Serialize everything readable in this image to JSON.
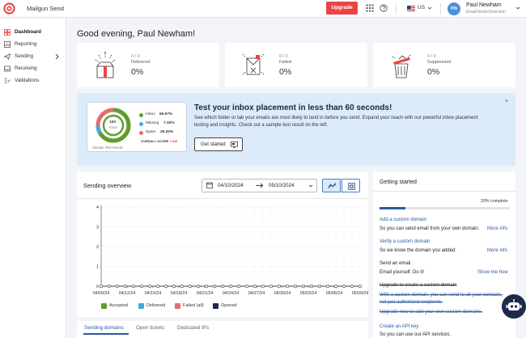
{
  "header": {
    "app_title": "Mailgun Send",
    "upgrade_label": "Upgrade",
    "region": "US",
    "user_initials": "PN",
    "user_name": "Paul Newham",
    "user_account": "EmailVendorSelection"
  },
  "sidebar": {
    "items": [
      {
        "label": "Dashboard",
        "icon": "dashboard-icon"
      },
      {
        "label": "Reporting",
        "icon": "reporting-icon"
      },
      {
        "label": "Sending",
        "icon": "send-icon"
      },
      {
        "label": "Receiving",
        "icon": "receiving-icon"
      },
      {
        "label": "Validations",
        "icon": "validations-icon"
      }
    ]
  },
  "main": {
    "greeting": "Good evening, Paul Newham!",
    "stats": [
      {
        "ratio": "0 / 0",
        "label": "Delivered",
        "percent": "0%"
      },
      {
        "ratio": "0 / 0",
        "label": "Failed",
        "percent": "0%"
      },
      {
        "ratio": "0 / 0",
        "label": "Suppressed",
        "percent": "0%"
      }
    ]
  },
  "promo": {
    "title": "Test your inbox placement in less than 60 seconds!",
    "description": "See which folder or tab your emails are most likely to land in before you send. Expand your reach with our powerful inbox placement testing and insights. Check out a sample test result on the left.",
    "button_label": "Get started",
    "close": "×",
    "sample": {
      "score": "100",
      "score_label": "Inbox",
      "rows": [
        {
          "label": "Inbox",
          "value": "66.67%",
          "color": "#5aa02c"
        },
        {
          "label": "Missing",
          "value": "7.33%",
          "color": "#4aa3df"
        },
        {
          "label": "Spam",
          "value": "26.00%",
          "color": "#e86a6a"
        }
      ],
      "overall_label": "OVERALL SCORE",
      "overall_value": "LOW",
      "caption": "Sample Test Result"
    }
  },
  "overview": {
    "title": "Sending overview",
    "date_from": "04/10/2024",
    "date_to": "05/10/2024"
  },
  "chart_data": {
    "type": "line",
    "categories": [
      "04/09/24",
      "04/12/24",
      "04/15/24",
      "04/18/24",
      "04/21/24",
      "04/24/24",
      "04/27/24",
      "04/30/24",
      "05/03/24",
      "05/06/24",
      "05/09/24"
    ],
    "ylim": [
      0,
      4
    ],
    "yticks": [
      "0",
      "1",
      "2",
      "3",
      "4"
    ],
    "series": [
      {
        "name": "Accepted",
        "color": "#5aa02c",
        "values": [
          0,
          0,
          0,
          0,
          0,
          0,
          0,
          0,
          0,
          0,
          0
        ]
      },
      {
        "name": "Delivered",
        "color": "#4aa3df",
        "values": [
          0,
          0,
          0,
          0,
          0,
          0,
          0,
          0,
          0,
          0,
          0
        ]
      },
      {
        "name": "Failed (all)",
        "color": "#e86a6a",
        "values": [
          0,
          0,
          0,
          0,
          0,
          0,
          0,
          0,
          0,
          0,
          0
        ]
      },
      {
        "name": "Opened",
        "color": "#1c2b4a",
        "values": [
          0,
          0,
          0,
          0,
          0,
          0,
          0,
          0,
          0,
          0,
          0
        ]
      }
    ],
    "grid": true
  },
  "tabs": [
    {
      "label": "Sending domains"
    },
    {
      "label": "Open tickets"
    },
    {
      "label": "Dedicated IPs"
    }
  ],
  "getting_started": {
    "title": "Getting started",
    "complete": "20% complete",
    "progress": 0.2,
    "add_domain": "Add a custom domain",
    "add_domain_desc": "So you can send email from your own domain.",
    "more_info_1": "More info",
    "verify_domain": "Verify a custom domain",
    "verify_desc": "So we know the domain you added.",
    "more_info_2": "More info",
    "send_email": "Send an email",
    "send_desc": "Email yourself. Do it!",
    "show_me": "Show me how",
    "upgrade_strike": "Upgrade to create a custom domain",
    "upgrade_strike_desc": "With a custom domain, you can send to all your contacts, not just authorized recipients.",
    "upgrade_strike_link": "Upgrade now to add your own custom domains.",
    "api_key": "Create an API key",
    "api_desc": "So you can use our API services."
  }
}
